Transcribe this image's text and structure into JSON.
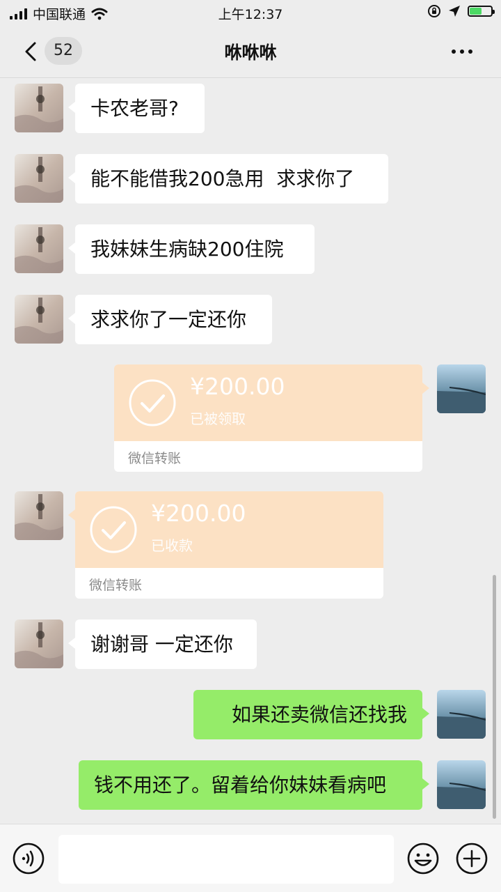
{
  "status_bar": {
    "carrier": "中国联通",
    "time": "上午12:37",
    "battery_level": 0.55,
    "battery_color": "#4cd964"
  },
  "nav": {
    "back_icon": "chevron-left-icon",
    "unread_count": "52",
    "title": "咻咻咻",
    "more_icon": "more-dots-icon"
  },
  "messages": [
    {
      "side": "in",
      "type": "text",
      "text": "卡农老哥?"
    },
    {
      "side": "in",
      "type": "text",
      "text": "能不能借我200急用  求求你了"
    },
    {
      "side": "in",
      "type": "text",
      "text": "我妹妹生病缺200住院"
    },
    {
      "side": "in",
      "type": "text",
      "text": "求求你了一定还你"
    },
    {
      "side": "out",
      "type": "transfer",
      "amount": "¥200.00",
      "status": "已被领取",
      "label": "微信转账"
    },
    {
      "side": "in",
      "type": "transfer",
      "amount": "¥200.00",
      "status": "已收款",
      "label": "微信转账"
    },
    {
      "side": "in",
      "type": "text",
      "text": "谢谢哥 一定还你"
    },
    {
      "side": "out",
      "type": "text",
      "text": "如果还卖微信还找我"
    },
    {
      "side": "out",
      "type": "text",
      "text": "钱不用还了。留着给你妹妹看病吧"
    }
  ],
  "input_bar": {
    "voice_icon": "voice-icon",
    "input_value": "",
    "emoji_icon": "emoji-icon",
    "plus_icon": "plus-circle-icon"
  },
  "colors": {
    "background": "#ededed",
    "bubble_out": "#95ec69",
    "bubble_in": "#ffffff",
    "transfer": "#fce1c4"
  }
}
